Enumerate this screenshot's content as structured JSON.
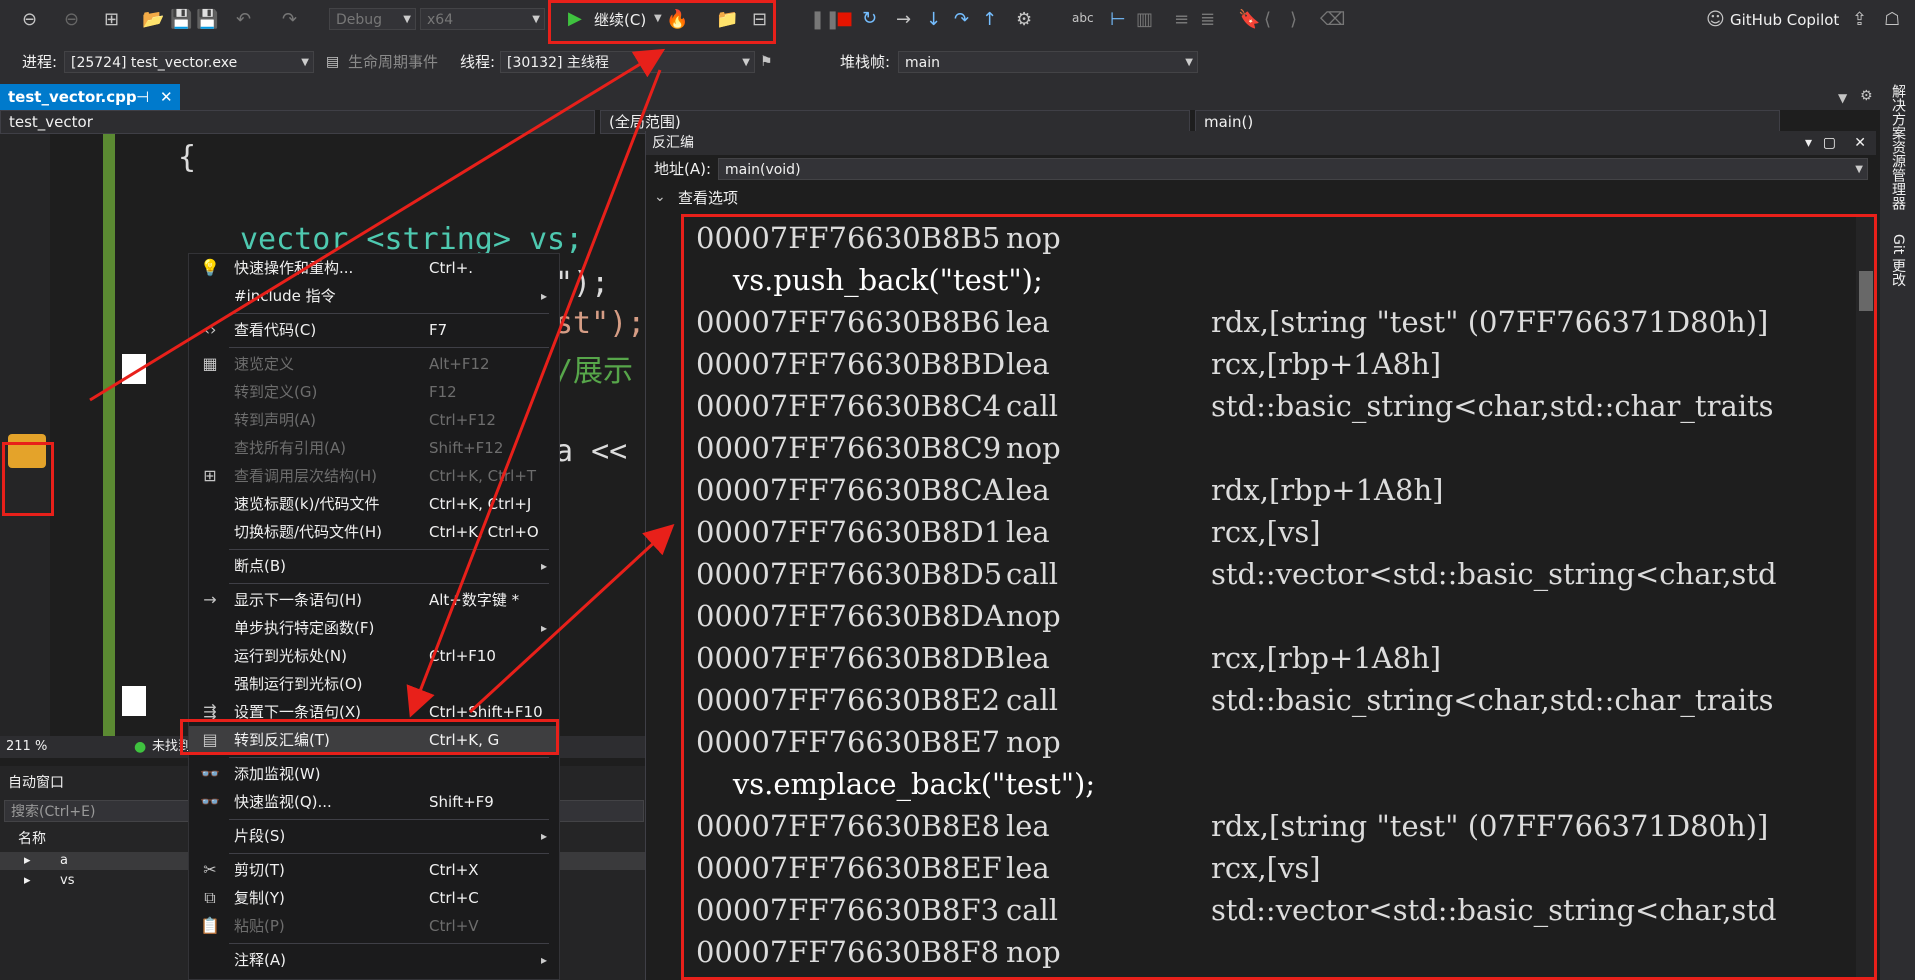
{
  "toolbar": {
    "config": "Debug",
    "platform": "x64",
    "continue_label": "继续(C)",
    "copilot": "GitHub Copilot"
  },
  "debug_bar": {
    "process_label": "进程:",
    "process_value": "[25724] test_vector.exe",
    "lifecycle_label": "生命周期事件",
    "thread_label": "线程:",
    "thread_value": "[30132] 主线程",
    "stack_label": "堆栈帧:",
    "stack_value": "main"
  },
  "tab": {
    "title": "test_vector.cpp",
    "pin": "⊣",
    "close": "✕"
  },
  "nav": {
    "project": "test_vector",
    "scope": "(全局范围)",
    "function": "main()"
  },
  "code": {
    "brace": "{",
    "line1": "vector <string> vs;",
    "frag2": "\");",
    "frag3": "st\");",
    "frag4": "/展示",
    "frag5": "a <<"
  },
  "status": {
    "zoom": "211 %",
    "status_text": "未找到"
  },
  "autos": {
    "title": "自动窗口",
    "search": "搜索(Ctrl+E)",
    "col_name": "名称",
    "rows": [
      "a",
      "vs"
    ]
  },
  "context_menu": {
    "items": [
      {
        "icon": "lightbulb-icon",
        "glyph": "💡",
        "label": "快速操作和重构...",
        "shortcut": "Ctrl+.",
        "sub": false,
        "disabled": false
      },
      {
        "icon": "",
        "glyph": "",
        "label": "#include 指令",
        "shortcut": "",
        "sub": true,
        "disabled": false
      },
      {
        "icon": "code-icon",
        "glyph": "‹›",
        "label": "查看代码(C)",
        "shortcut": "F7",
        "sub": false,
        "disabled": false
      },
      {
        "icon": "peek-icon",
        "glyph": "▦",
        "label": "速览定义",
        "shortcut": "Alt+F12",
        "sub": false,
        "disabled": true
      },
      {
        "icon": "",
        "glyph": "",
        "label": "转到定义(G)",
        "shortcut": "F12",
        "sub": false,
        "disabled": true
      },
      {
        "icon": "",
        "glyph": "",
        "label": "转到声明(A)",
        "shortcut": "Ctrl+F12",
        "sub": false,
        "disabled": true
      },
      {
        "icon": "",
        "glyph": "",
        "label": "查找所有引用(A)",
        "shortcut": "Shift+F12",
        "sub": false,
        "disabled": true
      },
      {
        "icon": "hierarchy-icon",
        "glyph": "⊞",
        "label": "查看调用层次结构(H)",
        "shortcut": "Ctrl+K, Ctrl+T",
        "sub": false,
        "disabled": true
      },
      {
        "icon": "",
        "glyph": "",
        "label": "速览标题(k)/代码文件",
        "shortcut": "Ctrl+K, Ctrl+J",
        "sub": false,
        "disabled": false
      },
      {
        "icon": "",
        "glyph": "",
        "label": "切换标题/代码文件(H)",
        "shortcut": "Ctrl+K, Ctrl+O",
        "sub": false,
        "disabled": false
      },
      {
        "icon": "",
        "glyph": "",
        "label": "断点(B)",
        "shortcut": "",
        "sub": true,
        "disabled": false
      },
      {
        "icon": "arrow-right-icon",
        "glyph": "→",
        "label": "显示下一条语句(H)",
        "shortcut": "Alt+数字键 *",
        "sub": false,
        "disabled": false
      },
      {
        "icon": "",
        "glyph": "",
        "label": "单步执行特定函数(F)",
        "shortcut": "",
        "sub": true,
        "disabled": false
      },
      {
        "icon": "",
        "glyph": "",
        "label": "运行到光标处(N)",
        "shortcut": "Ctrl+F10",
        "sub": false,
        "disabled": false
      },
      {
        "icon": "",
        "glyph": "",
        "label": "强制运行到光标(O)",
        "shortcut": "",
        "sub": false,
        "disabled": false
      },
      {
        "icon": "set-next-icon",
        "glyph": "⇶",
        "label": "设置下一条语句(X)",
        "shortcut": "Ctrl+Shift+F10",
        "sub": false,
        "disabled": false
      },
      {
        "icon": "disassembly-icon",
        "glyph": "▤",
        "label": "转到反汇编(T)",
        "shortcut": "Ctrl+K, G",
        "sub": false,
        "disabled": false
      },
      {
        "icon": "glasses-icon",
        "glyph": "👓",
        "label": "添加监视(W)",
        "shortcut": "",
        "sub": false,
        "disabled": false
      },
      {
        "icon": "glasses-icon",
        "glyph": "👓",
        "label": "快速监视(Q)...",
        "shortcut": "Shift+F9",
        "sub": false,
        "disabled": false
      },
      {
        "icon": "",
        "glyph": "",
        "label": "片段(S)",
        "shortcut": "",
        "sub": true,
        "disabled": false
      },
      {
        "icon": "scissors-icon",
        "glyph": "✂",
        "label": "剪切(T)",
        "shortcut": "Ctrl+X",
        "sub": false,
        "disabled": false
      },
      {
        "icon": "copy-icon",
        "glyph": "⧉",
        "label": "复制(Y)",
        "shortcut": "Ctrl+C",
        "sub": false,
        "disabled": false
      },
      {
        "icon": "paste-icon",
        "glyph": "📋",
        "label": "粘贴(P)",
        "shortcut": "Ctrl+V",
        "sub": false,
        "disabled": true
      },
      {
        "icon": "",
        "glyph": "",
        "label": "注释(A)",
        "shortcut": "",
        "sub": true,
        "disabled": false
      }
    ]
  },
  "disasm": {
    "title": "反汇编",
    "address_label": "地址(A):",
    "address_value": "main(void)",
    "view_options": "查看选项",
    "lines": [
      {
        "type": "asm",
        "addr": "00007FF76630B8B5",
        "mn": "nop",
        "op": ""
      },
      {
        "type": "src",
        "text": "    vs.push_back(\"test\");"
      },
      {
        "type": "asm",
        "addr": "00007FF76630B8B6",
        "mn": "lea",
        "op": "rdx,[string \"test\" (07FF766371D80h)]"
      },
      {
        "type": "asm",
        "addr": "00007FF76630B8BD",
        "mn": "lea",
        "op": "rcx,[rbp+1A8h]"
      },
      {
        "type": "asm",
        "addr": "00007FF76630B8C4",
        "mn": "call",
        "op": "std::basic_string<char,std::char_traits"
      },
      {
        "type": "asm",
        "addr": "00007FF76630B8C9",
        "mn": "nop",
        "op": ""
      },
      {
        "type": "asm",
        "addr": "00007FF76630B8CA",
        "mn": "lea",
        "op": "rdx,[rbp+1A8h]"
      },
      {
        "type": "asm",
        "addr": "00007FF76630B8D1",
        "mn": "lea",
        "op": "rcx,[vs]"
      },
      {
        "type": "asm",
        "addr": "00007FF76630B8D5",
        "mn": "call",
        "op": "std::vector<std::basic_string<char,std"
      },
      {
        "type": "asm",
        "addr": "00007FF76630B8DA",
        "mn": "nop",
        "op": ""
      },
      {
        "type": "asm",
        "addr": "00007FF76630B8DB",
        "mn": "lea",
        "op": "rcx,[rbp+1A8h]"
      },
      {
        "type": "asm",
        "addr": "00007FF76630B8E2",
        "mn": "call",
        "op": "std::basic_string<char,std::char_traits"
      },
      {
        "type": "asm",
        "addr": "00007FF76630B8E7",
        "mn": "nop",
        "op": ""
      },
      {
        "type": "src",
        "text": "    vs.emplace_back(\"test\");"
      },
      {
        "type": "asm",
        "addr": "00007FF76630B8E8",
        "mn": "lea",
        "op": "rdx,[string \"test\" (07FF766371D80h)]"
      },
      {
        "type": "asm",
        "addr": "00007FF76630B8EF",
        "mn": "lea",
        "op": "rcx,[vs]"
      },
      {
        "type": "asm",
        "addr": "00007FF76630B8F3",
        "mn": "call",
        "op": "std::vector<std::basic_string<char,std"
      },
      {
        "type": "asm",
        "addr": "00007FF76630B8F8",
        "mn": "nop",
        "op": ""
      }
    ]
  },
  "right_strip": {
    "solution_explorer": "解决方案资源管理器",
    "git_changes": "Git 更改"
  },
  "colors": {
    "accent": "#007acc",
    "annotation_red": "#e8201a",
    "continue_green": "#3fc23f"
  }
}
